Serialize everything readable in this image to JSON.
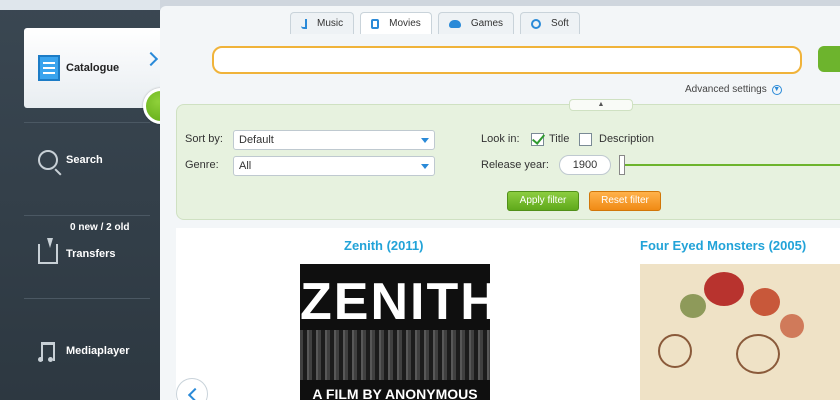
{
  "sidebar": {
    "catalogue_label": "Catalogue",
    "search_label": "Search",
    "transfers_count": "0 new / 2 old",
    "transfers_label": "Transfers",
    "mediaplayer_label": "Mediaplayer"
  },
  "tabs": [
    {
      "label": "Music",
      "icon": "music-note-icon",
      "color": "#2a8ad8"
    },
    {
      "label": "Movies",
      "icon": "film-icon",
      "color": "#2a8ad8"
    },
    {
      "label": "Games",
      "icon": "gamepad-icon",
      "color": "#2a8ad8"
    },
    {
      "label": "Soft",
      "icon": "soft-icon",
      "color": "#2a8ad8"
    }
  ],
  "search": {
    "value": "",
    "placeholder": ""
  },
  "advanced_settings": "Advanced settings",
  "filter": {
    "collapse_glyph": "▲",
    "sort_by_label": "Sort by:",
    "sort_by_value": "Default",
    "genre_label": "Genre:",
    "genre_value": "All",
    "look_in_label": "Look in:",
    "title_option": "Title",
    "title_checked": true,
    "description_option": "Description",
    "description_checked": false,
    "release_year_label": "Release year:",
    "release_year_value": "1900",
    "apply_label": "Apply filter",
    "reset_label": "Reset filter"
  },
  "films": [
    {
      "title": "Zenith (2011)",
      "poster_text": "ZENITH",
      "poster_subtext": "A FILM BY ANONYMOUS"
    },
    {
      "title": "Four Eyed Monsters (2005)"
    }
  ],
  "colors": {
    "accent_blue": "#22a3d8",
    "green": "#6db42d",
    "orange": "#f08a14",
    "search_border": "#f0b33a"
  }
}
